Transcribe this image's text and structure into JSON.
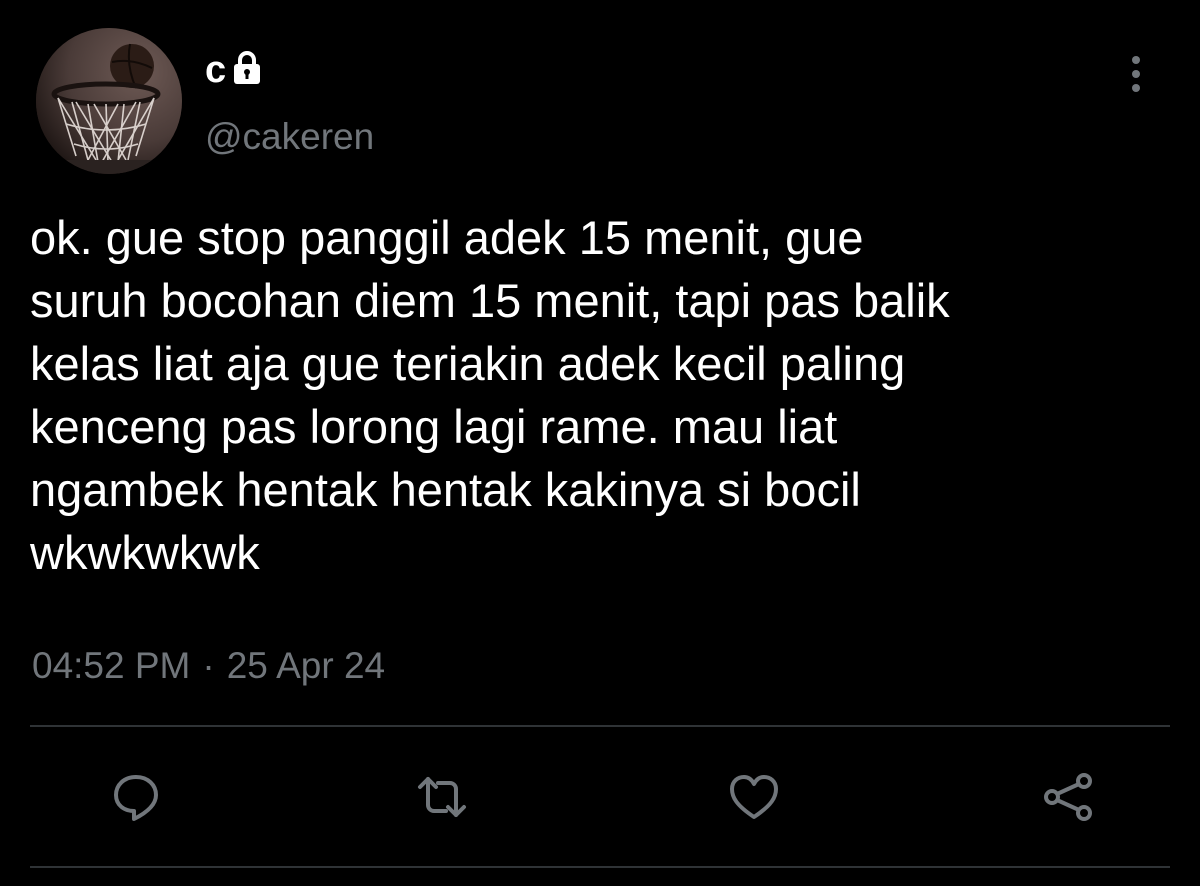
{
  "tweet": {
    "display_name": "c",
    "handle": "@cakeren",
    "text": "ok. gue stop panggil adek 15 menit, gue\nsuruh bocohan diem 15 menit, tapi pas balik\nkelas liat aja gue teriakin adek kecil paling\nkenceng pas lorong lagi rame. mau liat\nngambek hentak hentak kakinya si bocil\nwkwkwkwk",
    "time": "04:52 PM",
    "separator": "·",
    "date": "25 Apr 24",
    "protected": true
  },
  "icons": {
    "lock": "lock-icon",
    "more": "more-vertical-icon",
    "reply": "reply-icon",
    "retweet": "retweet-icon",
    "like": "like-icon",
    "share": "share-icon"
  },
  "colors": {
    "background": "#000000",
    "text": "#ffffff",
    "secondary": "#71767b",
    "divider": "#2f3336"
  }
}
